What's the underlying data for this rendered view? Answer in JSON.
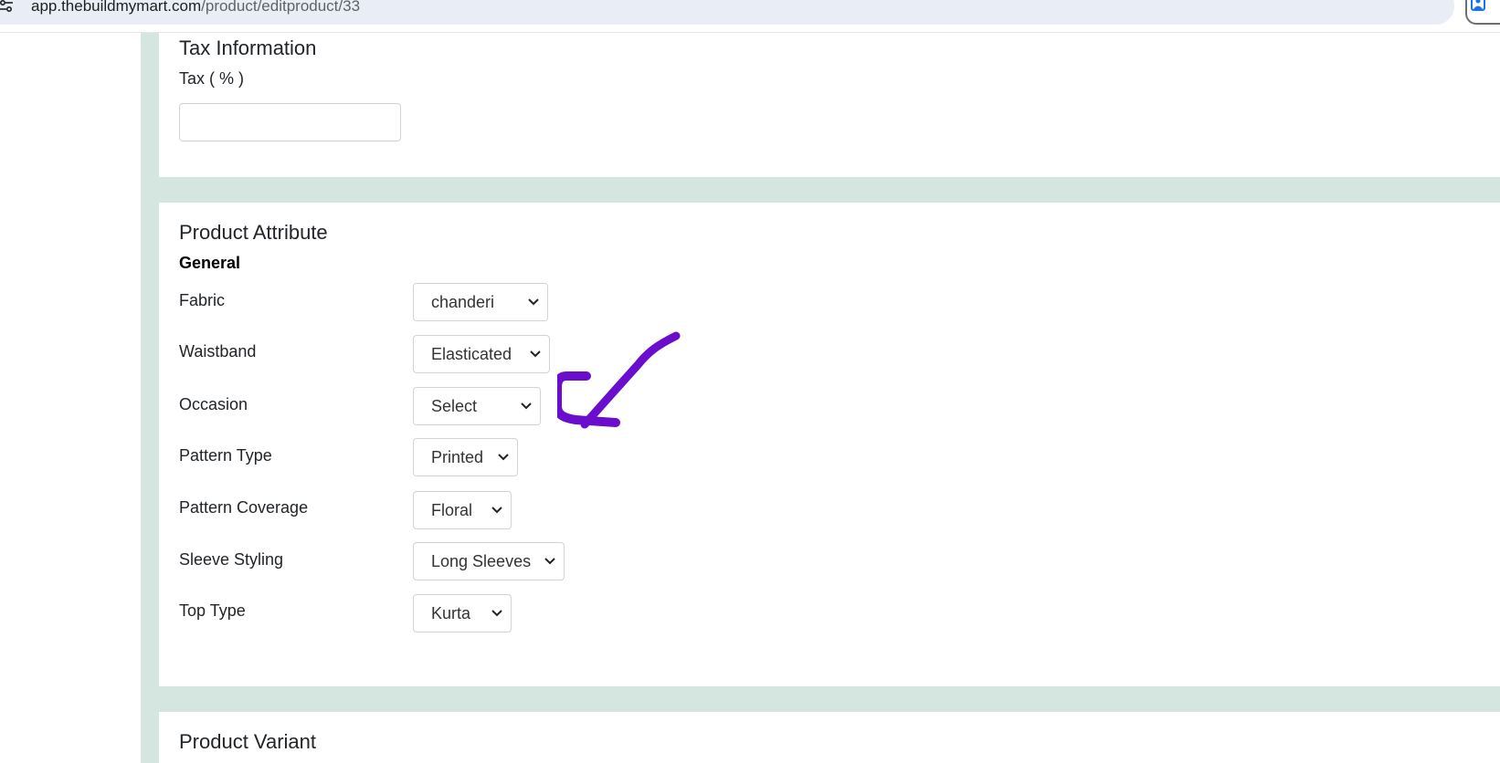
{
  "browser": {
    "url_domain": "app.thebuildmymart.com",
    "url_path": "/product/editproduct/33"
  },
  "tax_section": {
    "title": "Tax Information",
    "tax_label": "Tax ( % )",
    "tax_value": ""
  },
  "attribute_section": {
    "title": "Product Attribute",
    "group_heading": "General",
    "attributes": [
      {
        "label": "Fabric",
        "value": "chanderi"
      },
      {
        "label": "Waistband",
        "value": "Elasticated"
      },
      {
        "label": "Occasion",
        "value": "Select"
      },
      {
        "label": "Pattern Type",
        "value": "Printed"
      },
      {
        "label": "Pattern Coverage",
        "value": "Floral"
      },
      {
        "label": "Sleeve Styling",
        "value": "Long Sleeves"
      },
      {
        "label": "Top Type",
        "value": "Kurta"
      }
    ]
  },
  "variant_section": {
    "title": "Product Variant"
  },
  "colors": {
    "page_background": "#d5e6e1",
    "annotation": "#6a0dcc"
  }
}
